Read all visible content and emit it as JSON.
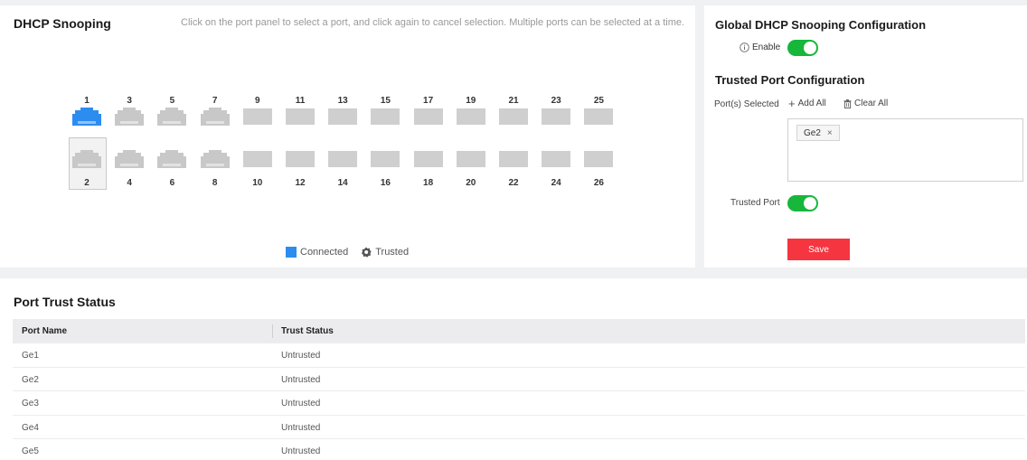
{
  "dhcp_panel": {
    "title": "DHCP Snooping",
    "hint": "Click on the port panel to select a port, and click again to cancel selection. Multiple ports can be selected at a time.",
    "top_ports": [
      "1",
      "3",
      "5",
      "7",
      "9",
      "11",
      "13",
      "15",
      "17",
      "19",
      "21",
      "23",
      "25"
    ],
    "bottom_ports": [
      "2",
      "4",
      "6",
      "8",
      "10",
      "12",
      "14",
      "16",
      "18",
      "20",
      "22",
      "24",
      "26"
    ],
    "connected_ports": [
      "1"
    ],
    "selected_ports": [
      "2"
    ],
    "legend": {
      "connected": "Connected",
      "trusted": "Trusted"
    }
  },
  "global_config": {
    "title": "Global DHCP Snooping Configuration",
    "enable_label": "Enable",
    "enable_state": true
  },
  "trusted_config": {
    "title": "Trusted Port Configuration",
    "ports_selected_label": "Port(s) Selected",
    "add_all": "Add All",
    "clear_all": "Clear All",
    "selected_tags": [
      "Ge2"
    ],
    "trusted_port_label": "Trusted Port",
    "trusted_state": true,
    "save": "Save"
  },
  "status_panel": {
    "title": "Port Trust Status",
    "columns": [
      "Port Name",
      "Trust Status"
    ],
    "rows": [
      [
        "Ge1",
        "Untrusted"
      ],
      [
        "Ge2",
        "Untrusted"
      ],
      [
        "Ge3",
        "Untrusted"
      ],
      [
        "Ge4",
        "Untrusted"
      ],
      [
        "Ge5",
        "Untrusted"
      ]
    ]
  },
  "colors": {
    "accent_connected": "#2d8cf0",
    "toggle_on": "#16b73a",
    "save_button": "#f5353f"
  }
}
